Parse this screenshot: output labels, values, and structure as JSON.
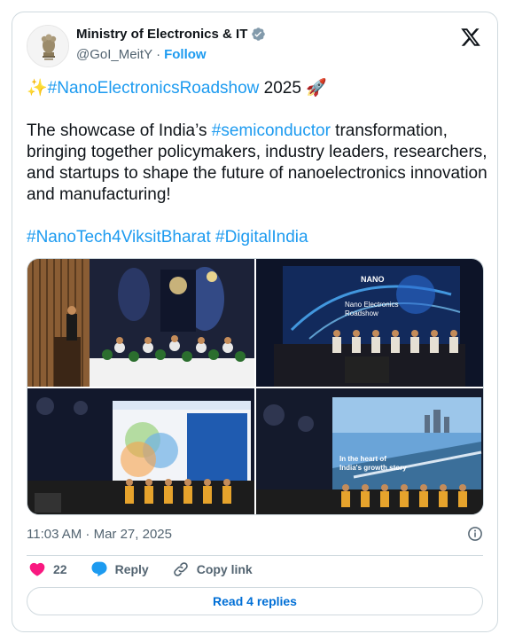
{
  "account": {
    "display_name": "Ministry of Electronics & IT",
    "handle": "@GoI_MeitY",
    "separator": "·",
    "follow_label": "Follow",
    "verified_icon": "verified-badge-icon",
    "brand_color": "#1d9bf0"
  },
  "tweet": {
    "line1_emoji_start": "✨",
    "line1_hashtag": "#NanoElectronicsRoadshow",
    "line1_year": " 2025 ",
    "line1_emoji_end": "🚀",
    "body_prefix": "The showcase of India’s ",
    "body_hashtag": "#semiconductor",
    "body_suffix": " transformation, bringing together policymakers, industry leaders, researchers, and startups to shape the future of nanoelectronics innovation and manufacturing!",
    "hashtag_1": "#NanoTech4ViksitBharat",
    "hashtag_2": "#DigitalIndia"
  },
  "media": {
    "photo_2_banner_title": "NANO\nElectronics\nRoadshow",
    "photo_2_banner_sub": "Nano Electronics\nRoadshow",
    "photo_4_screen_text_line1": "In the heart of",
    "photo_4_screen_text_line2": "India's growth story"
  },
  "meta": {
    "timestamp": "11:03 AM · Mar 27, 2025"
  },
  "actions": {
    "like_count": "22",
    "reply_label": "Reply",
    "copy_link_label": "Copy link",
    "like_color": "#f91880",
    "reply_color": "#1d9bf0"
  },
  "footer": {
    "read_replies_label": "Read 4 replies"
  }
}
